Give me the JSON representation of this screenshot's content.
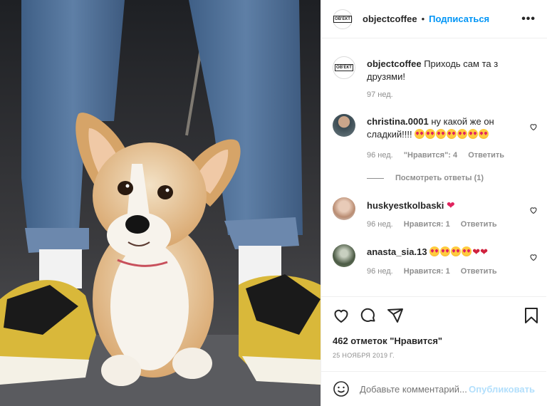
{
  "post": {
    "image_alt": "corgi puppy between legs in jeans and yellow sneakers"
  },
  "header": {
    "avatar_text": "OB'ЕКТ",
    "username": "objectcoffee",
    "dot": "•",
    "follow_label": "Подписаться",
    "more_label": "•••"
  },
  "caption": {
    "username": "objectcoffee",
    "text": "Приходь сам та з друзями!",
    "time": "97 нед."
  },
  "comments": [
    {
      "username": "christina.0001",
      "text": "ну какой же он сладкий!!!!",
      "time": "96 нед.",
      "likes": "\"Нравится\": 4",
      "reply": "Ответить",
      "view_replies": "Посмотреть ответы (1)"
    },
    {
      "username": "huskyestkolbaski",
      "text": "",
      "time": "96 нед.",
      "likes": "Нравится: 1",
      "reply": "Ответить"
    },
    {
      "username": "anastа_sia.13",
      "text": "",
      "time": "96 нед.",
      "likes": "Нравится: 1",
      "reply": "Ответить"
    }
  ],
  "likes_count": "462 отметок \"Нравится\"",
  "date": "25 НОЯБРЯ 2019 Г.",
  "add_comment": {
    "placeholder": "Добавьте комментарий...",
    "publish_label": "Опубликовать"
  },
  "icons": [
    "heart-icon",
    "comment-icon",
    "share-icon",
    "bookmark-icon",
    "emoji-icon"
  ]
}
